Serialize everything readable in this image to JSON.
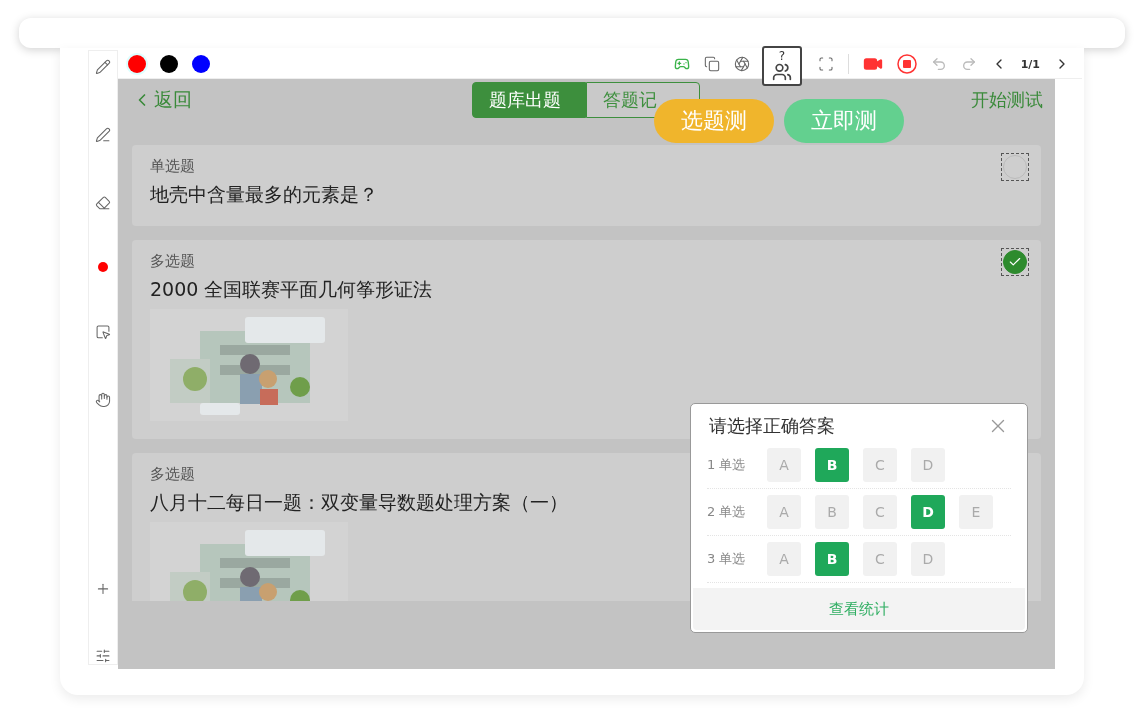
{
  "palette": [
    {
      "color": "#ff0000",
      "selected": true
    },
    {
      "color": "#000000",
      "selected": false
    },
    {
      "color": "#0000ff",
      "selected": false
    }
  ],
  "toolbar": {
    "page": "1/1",
    "quiz_mark": "?"
  },
  "header": {
    "back": "返回",
    "tabs": [
      {
        "label": "题库出题",
        "selected": true
      },
      {
        "label": "答题记",
        "selected": false
      }
    ],
    "start": "开始测试"
  },
  "bubbles": [
    {
      "label": "选题测",
      "kind": "pick"
    },
    {
      "label": "立即测",
      "kind": "now"
    }
  ],
  "questions": [
    {
      "type": "单选题",
      "title": "地壳中含量最多的元素是？",
      "checked": false
    },
    {
      "type": "多选题",
      "title": "2000 全国联赛平面几何筝形证法",
      "checked": true
    },
    {
      "type": "多选题",
      "title": "八月十二每日一题：双变量导数题处理方案（一）"
    }
  ],
  "answer_panel": {
    "title": "请选择正确答案",
    "rows": [
      {
        "number": "1",
        "type": "单选",
        "options": [
          {
            "label": "A",
            "selected": false
          },
          {
            "label": "B",
            "selected": true
          },
          {
            "label": "C",
            "selected": false
          },
          {
            "label": "D",
            "selected": false
          }
        ]
      },
      {
        "number": "2",
        "type": "单选",
        "options": [
          {
            "label": "A",
            "selected": false
          },
          {
            "label": "B",
            "selected": false
          },
          {
            "label": "C",
            "selected": false
          },
          {
            "label": "D",
            "selected": true
          },
          {
            "label": "E",
            "selected": false
          }
        ]
      },
      {
        "number": "3",
        "type": "单选",
        "options": [
          {
            "label": "A",
            "selected": false
          },
          {
            "label": "B",
            "selected": true
          },
          {
            "label": "C",
            "selected": false
          },
          {
            "label": "D",
            "selected": false
          }
        ]
      }
    ],
    "footer": "查看统计"
  }
}
